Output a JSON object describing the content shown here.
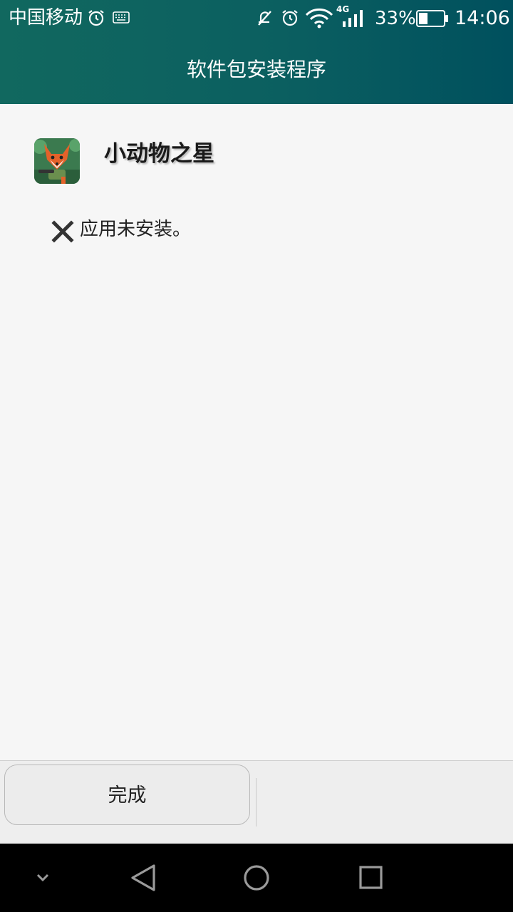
{
  "status_bar": {
    "carrier": "中国移动",
    "network": "4G",
    "battery_percent": "33%",
    "time": "14:06",
    "icons": [
      "alarm-icon",
      "keyboard-icon",
      "mute-icon",
      "alarm-icon",
      "wifi-icon",
      "signal-icon",
      "battery-icon"
    ]
  },
  "header": {
    "title": "软件包安装程序"
  },
  "app": {
    "name": "小动物之星",
    "icon": "fox-app-icon"
  },
  "install_status": {
    "icon": "close-icon",
    "message": "应用未安装。"
  },
  "actions": {
    "done_label": "完成"
  },
  "nav": {
    "buttons": [
      "chevron-down-icon",
      "back-icon",
      "home-icon",
      "recents-icon"
    ]
  },
  "colors": {
    "header": "#0b5f60",
    "background": "#f6f6f6",
    "panel": "#eeeeee"
  }
}
